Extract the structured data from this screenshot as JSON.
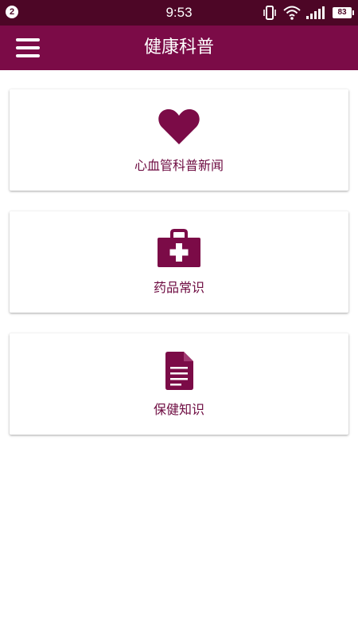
{
  "status_bar": {
    "notification_count": "2",
    "time": "9:53",
    "battery_level": "83",
    "icons": [
      "vibrate-icon",
      "wifi-icon",
      "signal-icon",
      "battery-icon"
    ]
  },
  "app_bar": {
    "title": "健康科普",
    "menu_icon": "hamburger-menu-icon"
  },
  "cards": [
    {
      "label": "心血管科普新闻",
      "icon": "heart-icon"
    },
    {
      "label": "药品常识",
      "icon": "medical-kit-icon"
    },
    {
      "label": "保健知识",
      "icon": "document-icon"
    }
  ],
  "colors": {
    "status_bar": "#4d0626",
    "app_bar": "#7b0b47",
    "accent": "#6d0a40",
    "background": "#ffffff"
  }
}
